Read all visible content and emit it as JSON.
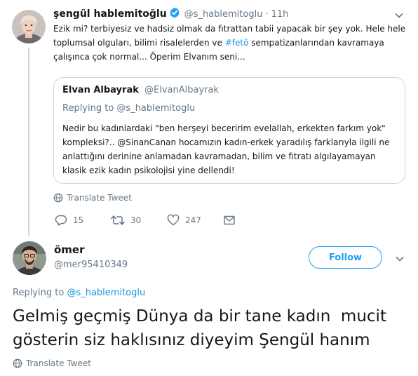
{
  "first_tweet": {
    "display_name": "şengül hablemitoğlu",
    "handle": "@s_hablemitoglu",
    "separator": "·",
    "time": "11h",
    "text_line1": "Ezik mi? terbiyesiz ve hadsiz olmak da fıtrattan tabii yapacak bir şey yok. Hele hele",
    "text_line2_before": "toplumsal olguları, bilimi risalelerden ve ",
    "hashtag": "#fetö",
    "text_line2_after": " sempatizanlarından kavramaya",
    "text_line3": "çalışınca çok normal... Öperim Elvanım seni...",
    "quoted": {
      "display_name": "Elvan Albayrak",
      "handle": "@ElvanAlbayrak",
      "replying_to": "Replying to @s_hablemitoglu",
      "line1": "Nedir bu kadınlardaki \"ben herşeyi beceririm evelallah, erkekten farkım yok\"",
      "line2": "kompleksi?.. @SinanCanan hocamızın kadın-erkek yaradılış farklarıyla ilgili ne",
      "line3": "anlattığını derinine anlamadan kavramadan, bilim ve fıtratı algılayamayan",
      "line4": "klasik ezik kadın psikolojisi yine dellendi!"
    },
    "translate": "Translate Tweet",
    "replies": "15",
    "retweets": "30",
    "likes": "247"
  },
  "second_tweet": {
    "display_name": "ömer",
    "handle": "@mer95410349",
    "follow_label": "Follow",
    "replying_label": "Replying to ",
    "replying_handle": "@s_hablemitoglu",
    "text_line1": "Gelmiş geçmiş Dünya da bir tane kadın  mucit",
    "text_line2": "gösterin siz haklısınız diyeyim Şengül hanım",
    "translate": "Translate Tweet"
  },
  "colors": {
    "accent": "#1da1f2",
    "link": "#1b95e0",
    "muted": "#657786",
    "border": "#ccd6dd"
  }
}
